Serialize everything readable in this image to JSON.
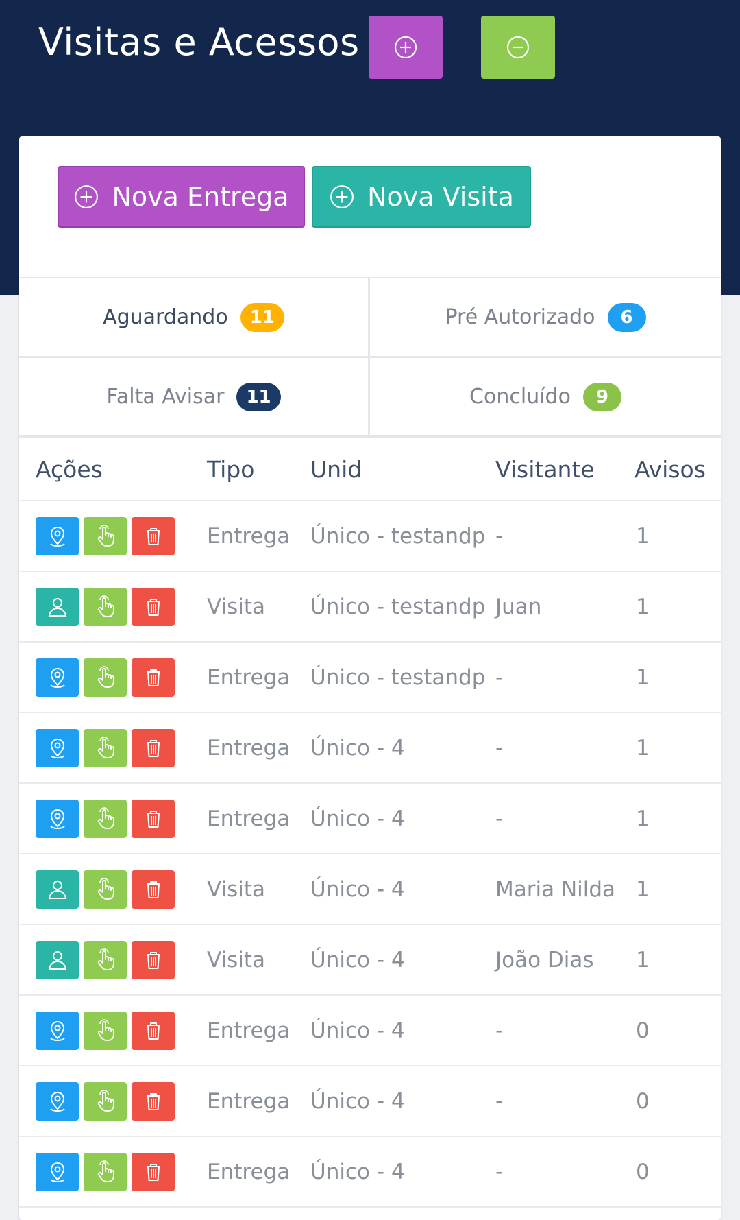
{
  "header": {
    "title": "Visitas e Acessos"
  },
  "actions": {
    "new_delivery": "Nova Entrega",
    "new_visit": "Nova Visita"
  },
  "tabs": [
    {
      "label": "Aguardando",
      "count": "11",
      "color": "#ffb300",
      "active": true
    },
    {
      "label": "Pré Autorizado",
      "count": "6",
      "color": "#1e9ff2",
      "active": false
    },
    {
      "label": "Falta Avisar",
      "count": "11",
      "color": "#1b3a66",
      "active": false
    },
    {
      "label": "Concluído",
      "count": "9",
      "color": "#8bc34a",
      "active": false
    }
  ],
  "table": {
    "columns": [
      "Ações",
      "Tipo",
      "Unid",
      "Visitante",
      "Avisos"
    ],
    "rows": [
      {
        "tipo": "Entrega",
        "unid": "Único - testandp",
        "visitante": "-",
        "avisos": "1",
        "first_icon": "map-pin-icon"
      },
      {
        "tipo": "Visita",
        "unid": "Único - testandp",
        "visitante": "Juan",
        "avisos": "1",
        "first_icon": "user-icon"
      },
      {
        "tipo": "Entrega",
        "unid": "Único - testandp",
        "visitante": "-",
        "avisos": "1",
        "first_icon": "map-pin-icon"
      },
      {
        "tipo": "Entrega",
        "unid": "Único - 4",
        "visitante": "-",
        "avisos": "1",
        "first_icon": "map-pin-icon"
      },
      {
        "tipo": "Entrega",
        "unid": "Único - 4",
        "visitante": "-",
        "avisos": "1",
        "first_icon": "map-pin-icon"
      },
      {
        "tipo": "Visita",
        "unid": "Único - 4",
        "visitante": "Maria Nilda",
        "avisos": "1",
        "first_icon": "user-icon"
      },
      {
        "tipo": "Visita",
        "unid": "Único - 4",
        "visitante": "João Dias",
        "avisos": "1",
        "first_icon": "user-icon"
      },
      {
        "tipo": "Entrega",
        "unid": "Único - 4",
        "visitante": "-",
        "avisos": "0",
        "first_icon": "map-pin-icon"
      },
      {
        "tipo": "Entrega",
        "unid": "Único - 4",
        "visitante": "-",
        "avisos": "0",
        "first_icon": "map-pin-icon"
      },
      {
        "tipo": "Entrega",
        "unid": "Único - 4",
        "visitante": "-",
        "avisos": "0",
        "first_icon": "map-pin-icon"
      }
    ]
  },
  "colors": {
    "header_bg": "#12274b",
    "purple": "#b152c7",
    "green": "#8fca51",
    "teal": "#2bb5a6",
    "blue": "#1e9ff2",
    "red": "#ef5144"
  }
}
